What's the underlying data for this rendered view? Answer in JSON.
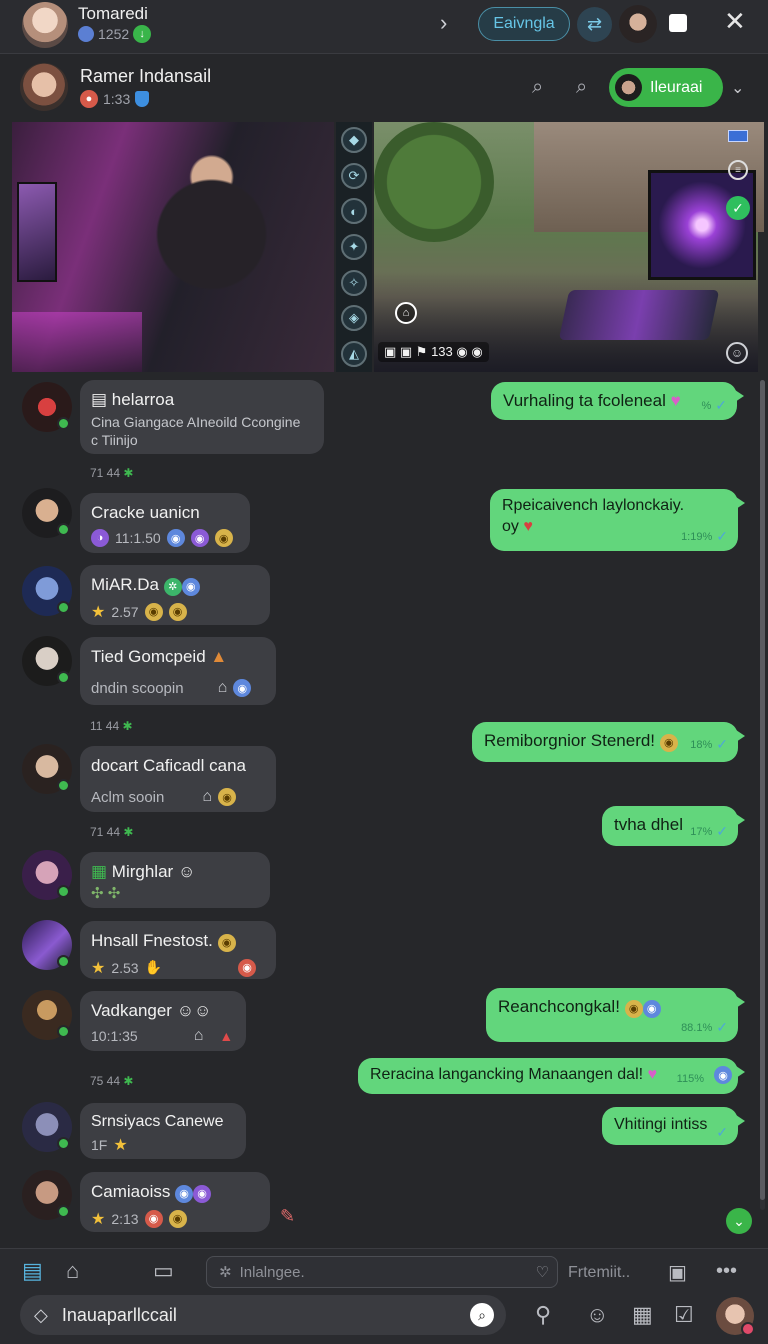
{
  "topbar": {
    "title": "Tomaredi",
    "count": "1252",
    "pill_label": "Eaivngla"
  },
  "header": {
    "name": "Ramer Indansail",
    "status": "1:33",
    "pill_label": "Ileuraai"
  },
  "media": {
    "status_text": "133"
  },
  "messages": {
    "in": [
      {
        "title": "helarroa",
        "line1": "Cina Giangace AIneoild Ccongine",
        "line2": "c Tiinijo"
      },
      {
        "title": "Cracke uanicn",
        "sub": "11:1.50"
      },
      {
        "title": "MiAR.Da",
        "sub": "2.57"
      },
      {
        "title": "Tied Gomcpeid",
        "sub": "dndin scoopin"
      },
      {
        "title": "docart Caficadl cana",
        "sub": "Aclm sooin"
      },
      {
        "title": "Mirghlar",
        "sub": ""
      },
      {
        "title": "Hnsall Fnestost.",
        "sub": "2.53"
      },
      {
        "title": "Vadkanger",
        "sub": "10:1:35"
      },
      {
        "title": "Srnsiyacs Canewe",
        "sub": "1F"
      },
      {
        "title": "Camiaoiss",
        "sub": "2:13"
      }
    ],
    "out": [
      {
        "text": "Vurhaling ta fcoleneal",
        "meta": "%"
      },
      {
        "text": "Rpeicaivench laylonckaiy.",
        "text2": "oy",
        "meta": "1:19%"
      },
      {
        "text": "Remiborgnior Stenerd!",
        "meta": "18%"
      },
      {
        "text": "tvha dhel",
        "meta": "17%"
      },
      {
        "text": "Reanchcongkal!",
        "meta": "88.1%"
      },
      {
        "text": "Reracina langancking Manaangen dal!",
        "meta": "115%"
      },
      {
        "text": "Vhitingi intiss",
        "meta": ""
      }
    ],
    "timestamps": [
      "71 44",
      "11 44",
      "71 44",
      "75 44"
    ]
  },
  "bottom": {
    "compose_placeholder": "Inlalngee.",
    "hint": "Frtemiit..",
    "input_text": "Inauaparllccail"
  },
  "colors": {
    "background": "#26272a",
    "bubble_in": "#3d3e43",
    "bubble_out": "#62d67c",
    "accent_green": "#3ab549",
    "accent_blue": "#66c5e6"
  }
}
